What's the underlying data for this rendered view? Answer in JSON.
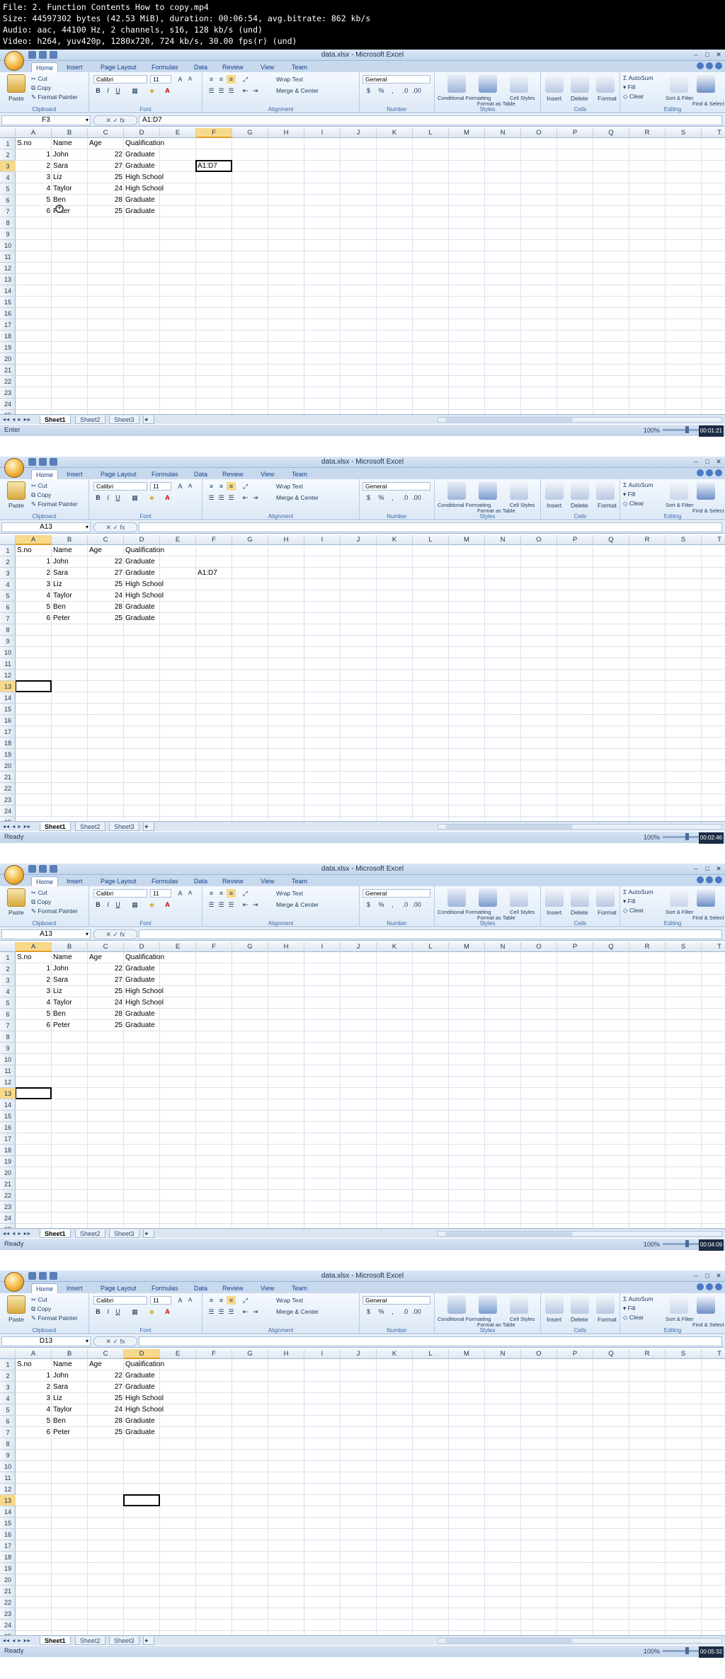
{
  "video_info": {
    "line1": "File: 2. Function Contents How to copy.mp4",
    "line2": "Size: 44597302 bytes (42.53 MiB), duration: 00:06:54, avg.bitrate: 862 kb/s",
    "line3": "Audio: aac, 44100 Hz, 2 channels, s16, 128 kb/s (und)",
    "line4": "Video: h264, yuv420p, 1280x720, 724 kb/s, 30.00 fps(r) (und)"
  },
  "app": {
    "title": "data.xlsx - Microsoft Excel",
    "tabs": [
      "Home",
      "Insert",
      "Page Layout",
      "Formulas",
      "Data",
      "Review",
      "View",
      "Team"
    ],
    "ribbon": {
      "paste": "Paste",
      "cut": "Cut",
      "copy": "Copy",
      "format_painter": "Format Painter",
      "clipboard": "Clipboard",
      "font_name": "Calibri",
      "font_size": "11",
      "font": "Font",
      "wrap_text": "Wrap Text",
      "merge_center": "Merge & Center",
      "alignment": "Alignment",
      "number_format": "General",
      "number": "Number",
      "conditional": "Conditional Formatting",
      "format_table": "Format as Table",
      "cell_styles": "Cell Styles",
      "styles": "Styles",
      "insert": "Insert",
      "delete": "Delete",
      "format": "Format",
      "cells": "Cells",
      "autosum": "AutoSum",
      "fill": "Fill",
      "clear": "Clear",
      "sort_filter": "Sort & Filter",
      "find_select": "Find & Select",
      "editing": "Editing"
    },
    "columns": [
      "A",
      "B",
      "C",
      "D",
      "E",
      "F",
      "G",
      "H",
      "I",
      "J",
      "K",
      "L",
      "M",
      "N",
      "O",
      "P",
      "Q",
      "R",
      "S",
      "T"
    ],
    "sheets": [
      "Sheet1",
      "Sheet2",
      "Sheet3"
    ],
    "zoom": "100%",
    "table": {
      "headers": [
        "S.no",
        "Name",
        "Age",
        "Qualification"
      ],
      "rows": [
        [
          "1",
          "John",
          "22",
          "Graduate"
        ],
        [
          "2",
          "Sara",
          "27",
          "Graduate"
        ],
        [
          "3",
          "Liz",
          "25",
          "High School"
        ],
        [
          "4",
          "Taylor",
          "24",
          "High School"
        ],
        [
          "5",
          "Ben",
          "28",
          "Graduate"
        ],
        [
          "6",
          "Peter",
          "25",
          "Graduate"
        ]
      ]
    }
  },
  "frames": [
    {
      "name_box": "F3",
      "formula": "A1:D7",
      "f3_value": "A1:D7",
      "status": "Enter",
      "timestamp": "00:01:21",
      "active_col": "F",
      "active_row": "3"
    },
    {
      "name_box": "A13",
      "formula": "",
      "f3_value": "A1:D7",
      "status": "Ready",
      "timestamp": "00:02:46",
      "active_col": "A",
      "active_row": "13"
    },
    {
      "name_box": "A13",
      "formula": "",
      "f3_value": "",
      "status": "Ready",
      "timestamp": "00:04:09",
      "active_col": "A",
      "active_row": "13"
    },
    {
      "name_box": "D13",
      "formula": "",
      "f3_value": "",
      "status": "Ready",
      "timestamp": "00:05:32",
      "active_col": "D",
      "active_row": "13"
    }
  ]
}
